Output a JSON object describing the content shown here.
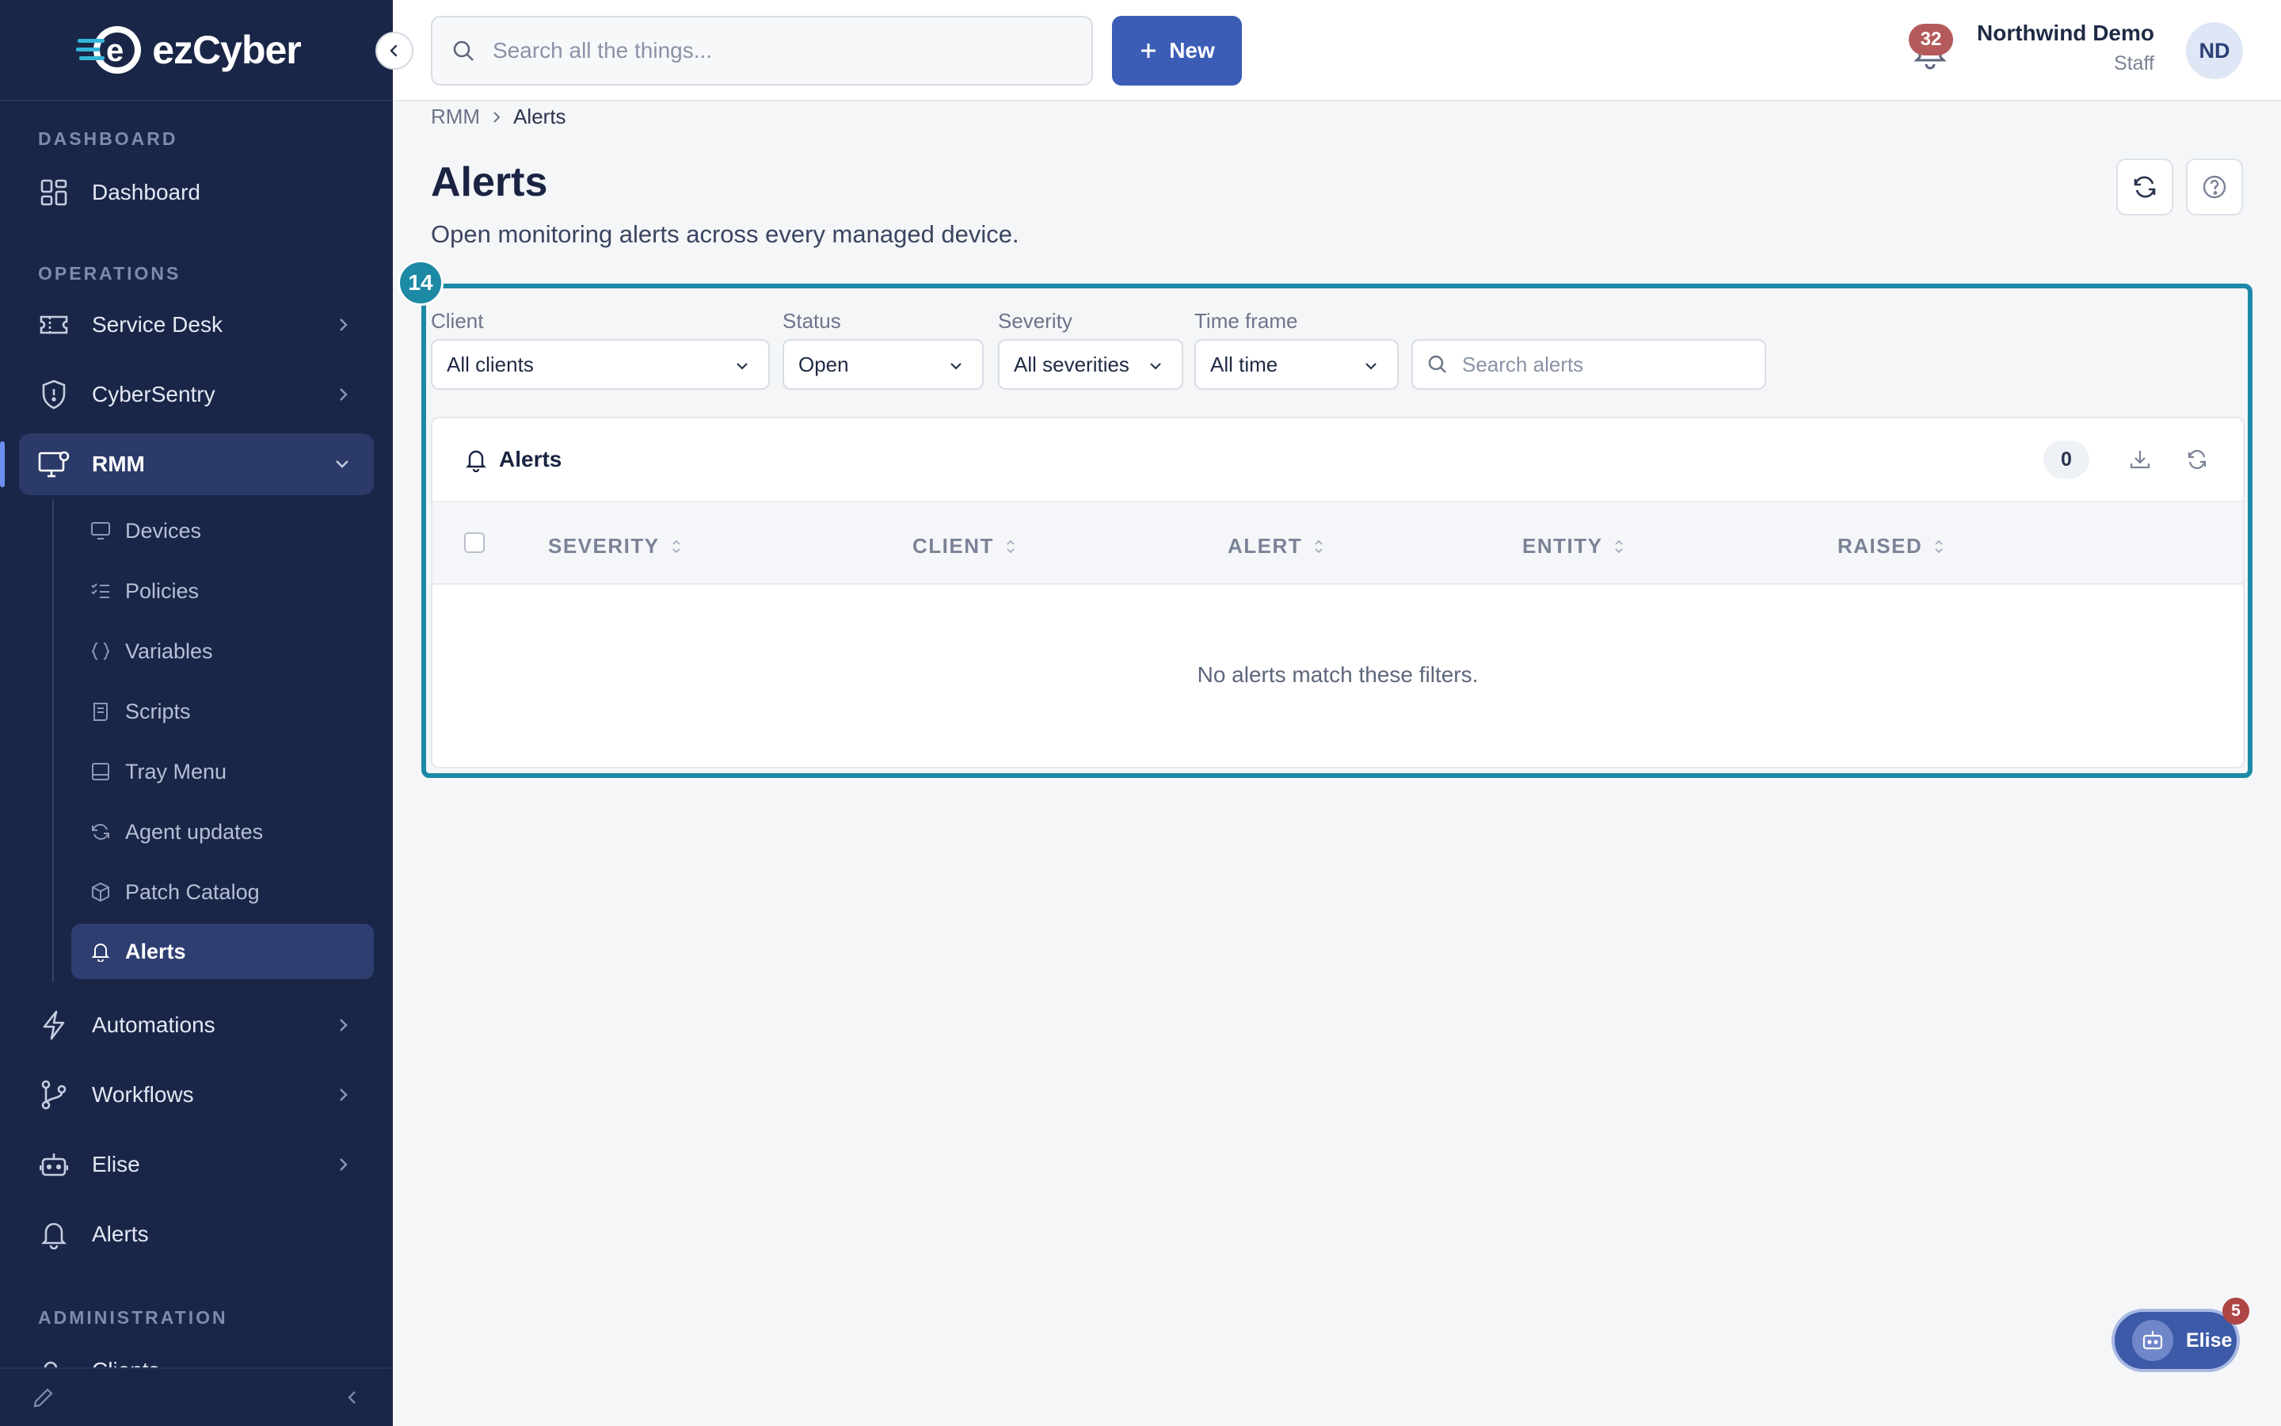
{
  "app": {
    "brand": "ezCyber",
    "accent_color": "#3b5db5",
    "sidebar_color": "#1a2647"
  },
  "header": {
    "search_placeholder": "Search all the things...",
    "new_button_label": "New",
    "notification_count": "32",
    "user_name": "Northwind Demo",
    "user_role": "Staff",
    "user_initials": "ND"
  },
  "sidebar": {
    "sections": {
      "dashboard": "DASHBOARD",
      "operations": "OPERATIONS",
      "administration": "ADMINISTRATION"
    },
    "items": {
      "dashboard": "Dashboard",
      "service_desk": "Service Desk",
      "cybersentry": "CyberSentry",
      "rmm": "RMM",
      "automations": "Automations",
      "workflows": "Workflows",
      "elise": "Elise",
      "alerts": "Alerts",
      "clients": "Clients"
    },
    "rmm_children": [
      {
        "label": "Devices",
        "icon": "monitor-icon"
      },
      {
        "label": "Policies",
        "icon": "checklist-icon"
      },
      {
        "label": "Variables",
        "icon": "braces-icon"
      },
      {
        "label": "Scripts",
        "icon": "scroll-icon"
      },
      {
        "label": "Tray Menu",
        "icon": "tray-icon"
      },
      {
        "label": "Agent updates",
        "icon": "refresh-icon"
      },
      {
        "label": "Patch Catalog",
        "icon": "package-icon"
      },
      {
        "label": "Alerts",
        "icon": "bell-icon"
      }
    ],
    "active_item": "Alerts"
  },
  "breadcrumb": {
    "parent": "RMM",
    "current": "Alerts"
  },
  "page": {
    "title": "Alerts",
    "subtitle": "Open monitoring alerts across every managed device.",
    "marker_number": "14"
  },
  "filters": {
    "client": {
      "label": "Client",
      "value": "All clients"
    },
    "status": {
      "label": "Status",
      "value": "Open"
    },
    "severity": {
      "label": "Severity",
      "value": "All severities"
    },
    "time_frame": {
      "label": "Time frame",
      "value": "All time"
    },
    "search_placeholder": "Search alerts"
  },
  "alerts_card": {
    "title": "Alerts",
    "count": "0",
    "columns": [
      "SEVERITY",
      "CLIENT",
      "ALERT",
      "ENTITY",
      "RAISED"
    ],
    "rows": [],
    "empty_message": "No alerts match these filters."
  },
  "elise_widget": {
    "label": "Elise",
    "badge": "5"
  }
}
